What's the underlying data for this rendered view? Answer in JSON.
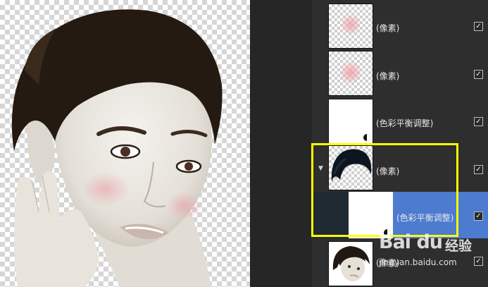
{
  "layers": [
    {
      "name": "(像素)",
      "thumb": "pink-pixels",
      "visible": "✓"
    },
    {
      "name": "(像素)",
      "thumb": "pink-pixels",
      "visible": "✓"
    },
    {
      "name": "(色彩平衡调整)",
      "thumb": "white-adjustment",
      "visible": "✓"
    },
    {
      "name": "(像素)",
      "thumb": "hair-mask",
      "visible": "✓",
      "group_toggle": "▼"
    },
    {
      "name": "(色彩平衡调整)",
      "thumb": "white-adjustment",
      "visible": "✓",
      "selected": true
    },
    {
      "name": "(像素)",
      "thumb": "portrait",
      "visible": "✓"
    }
  ],
  "watermark": {
    "logo": "Bai du",
    "text": "经验",
    "url": "jingyan.baidu.com"
  },
  "colors": {
    "panel_bg": "#2e2e2e",
    "selected_bg": "#4d7bd0",
    "highlight": "#ffff00"
  }
}
